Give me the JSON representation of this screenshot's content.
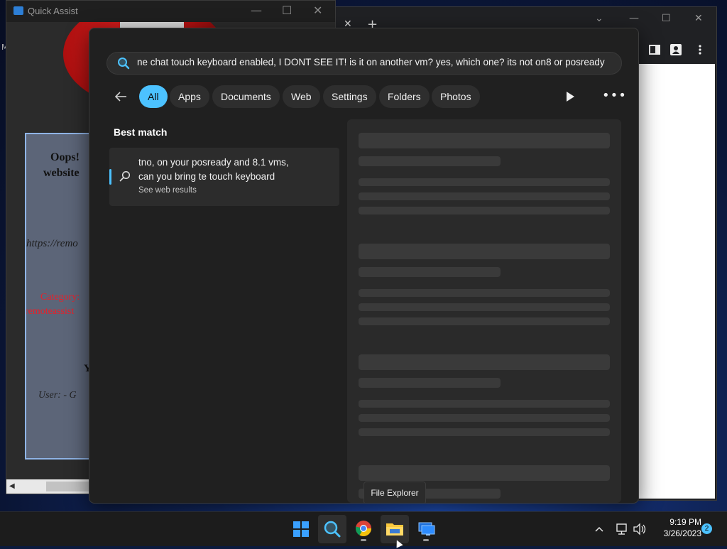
{
  "quick_assist": {
    "title": "Quick Assist",
    "page_text": {
      "oops": "Oops!",
      "website": "website",
      "url": "https://remo",
      "category": "Category:",
      "category_value": "remoteassist",
      "y": "Y",
      "user": "User: -   G"
    }
  },
  "left_edge_letter": "M",
  "search": {
    "query": "ne chat touch keyboard enabled, I DONT SEE IT! is it on another vm? yes, which one? its not on8 or posready",
    "filters": [
      "All",
      "Apps",
      "Documents",
      "Web",
      "Settings",
      "Folders",
      "Photos"
    ],
    "active_filter": "All",
    "best_match_label": "Best match",
    "best_match": {
      "line1": "tno, on your posready and 8.1 vms,",
      "line2": "can you bring te touch keyboard",
      "sub": "See web results"
    }
  },
  "tooltip": "File Explorer",
  "taskbar": {
    "apps": [
      "start-icon",
      "search-icon",
      "chrome-icon",
      "file-explorer-icon",
      "quick-assist-icon"
    ],
    "time": "9:19 PM",
    "date": "3/26/2023",
    "notifications": "2"
  },
  "colors": {
    "accent": "#4cc2ff",
    "panel": "#202020",
    "taskbar": "#1c1c1c"
  }
}
